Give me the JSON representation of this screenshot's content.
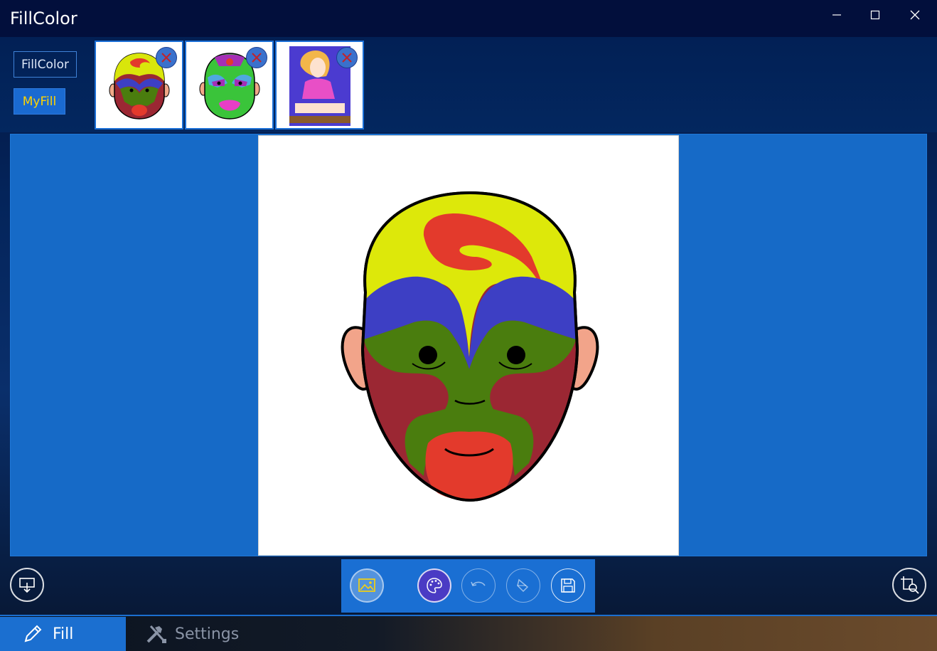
{
  "window": {
    "title": "FillColor"
  },
  "header_tabs": [
    {
      "label": "FillColor"
    },
    {
      "label": "MyFill"
    }
  ],
  "thumbnails": [
    {
      "icon": "opera-mask-red-yellow"
    },
    {
      "icon": "opera-mask-green-pink"
    },
    {
      "icon": "girl-portrait"
    }
  ],
  "toolbar": {
    "buttons": [
      "image-icon",
      "palette-icon",
      "undo-icon",
      "fill-bucket-icon",
      "save-icon"
    ]
  },
  "bottom_nav": {
    "fill_label": "Fill",
    "settings_label": "Settings"
  },
  "colors": {
    "accent": "#1b6fd0",
    "myfill_text": "#ffd400",
    "canvas_bg": "#166ac7"
  }
}
